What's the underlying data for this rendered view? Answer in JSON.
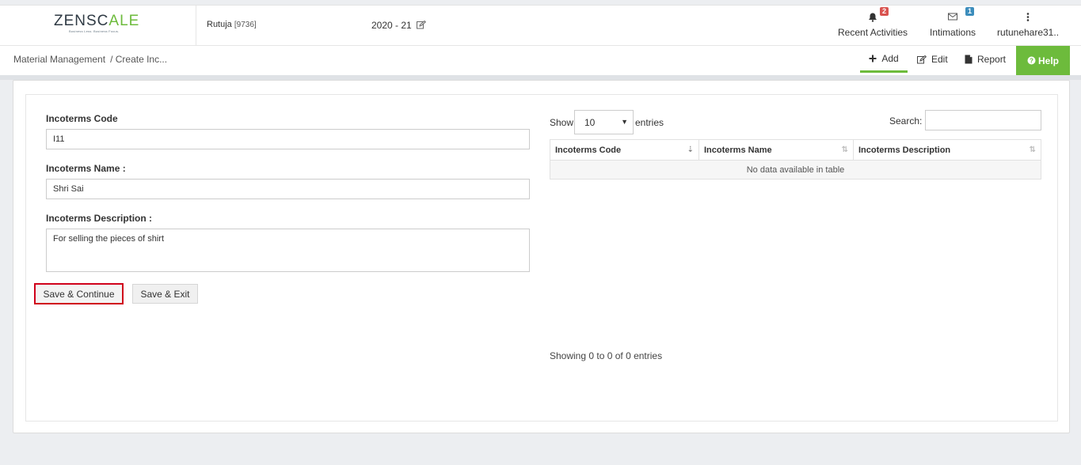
{
  "header": {
    "logo_main": "ZENSC",
    "logo_accent": "ALE",
    "logo_tagline": "Business Less. Business Focus.",
    "user_name": "Rutuja",
    "user_id": "[9736]",
    "fiscal_year": "2020 - 21",
    "nav": [
      {
        "label": "Recent Activities",
        "badge": "2",
        "icon": "bell-icon"
      },
      {
        "label": "Intimations",
        "badge": "1",
        "icon": "envelope-icon"
      },
      {
        "label": "rutunehare31..",
        "icon": "vertical-dots-icon"
      }
    ]
  },
  "breadcrumb": {
    "root": "Material Management",
    "current": "/ Create Inc..."
  },
  "actions": {
    "add": "Add",
    "edit": "Edit",
    "report": "Report",
    "help": "Help"
  },
  "form": {
    "code_label": "Incoterms Code",
    "code_value": "I11",
    "name_label": "Incoterms Name :",
    "name_value": "Shri Sai",
    "desc_label": "Incoterms Description :",
    "desc_value": "For selling the pieces of shirt",
    "save_continue": "Save & Continue",
    "save_exit": "Save & Exit"
  },
  "table": {
    "show_label": "Show",
    "page_length": "10",
    "entries_label": "entries",
    "search_label": "Search:",
    "columns": [
      "Incoterms Code",
      "Incoterms Name",
      "Incoterms Description"
    ],
    "empty_message": "No data available in table",
    "info": "Showing 0 to 0 of 0 entries"
  },
  "colors": {
    "accent_green": "#6dbb3c",
    "highlight_red": "#d0021b",
    "badge_red": "#d9534f",
    "badge_blue": "#3c8dbc"
  }
}
